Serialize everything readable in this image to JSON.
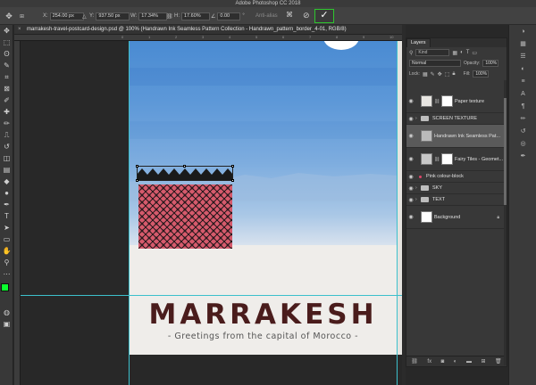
{
  "app": {
    "title": "Adobe Photoshop CC 2018"
  },
  "options_bar": {
    "x_label": "X:",
    "x_value": "254.00 px",
    "y_label": "Y:",
    "y_value": "937.50 px",
    "w_label": "W:",
    "w_value": "17.34%",
    "h_label": "H:",
    "h_value": "17.60%",
    "angle_value": "0.00",
    "angle_unit": "°",
    "antialias_label": "Anti-alias",
    "commit_icon": "✓",
    "cancel_icon": "⊘"
  },
  "document": {
    "tab_title": "marrakesh-travel-postcard-design.psd @ 100% (Handrawn Ink Seamless Pattern Collection - Handrawn_pattern_border_4-01, RGB/8)",
    "close_glyph": "×",
    "ruler_ticks": [
      "0",
      "1",
      "2",
      "3",
      "4",
      "5",
      "6",
      "7",
      "8",
      "9",
      "10"
    ]
  },
  "artwork": {
    "headline": "MARRAKESH",
    "subline": "- Greetings from the capital of Morocco -",
    "pink_color": "#d65a6c",
    "headline_color": "#4a1c1c"
  },
  "layers_panel": {
    "tab_label": "Layers",
    "kind_placeholder": "Kind",
    "blend_mode": "Normal",
    "opacity_label": "Opacity:",
    "opacity_value": "100%",
    "lock_label": "Lock:",
    "fill_label": "Fill:",
    "fill_value": "100%",
    "layers": [
      {
        "name": "Paper texture",
        "type": "layer",
        "visible": true
      },
      {
        "name": "SCREEN TEXTURE",
        "type": "group",
        "visible": true
      },
      {
        "name": "Handrawn Ink Seamless Pat...",
        "type": "layer",
        "visible": true,
        "selected": true
      },
      {
        "name": "Fairy Tiles - Geomet...",
        "type": "layer-mask",
        "visible": true
      },
      {
        "name": "Pink colour-block",
        "type": "shape",
        "visible": true
      },
      {
        "name": "SKY",
        "type": "group",
        "visible": true
      },
      {
        "name": "TEXT",
        "type": "group",
        "visible": true
      },
      {
        "name": "Background",
        "type": "locked",
        "visible": true
      }
    ]
  },
  "foreground_color": "#0aff2e",
  "background_color": "#ffffff"
}
